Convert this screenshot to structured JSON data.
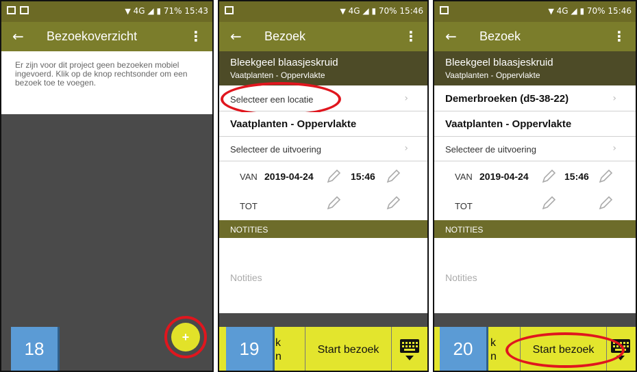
{
  "screens": [
    {
      "status": {
        "signal": "4G",
        "battery": "71%",
        "time": "15:43"
      },
      "title": "Bezoekoverzicht",
      "message": "Er zijn voor dit project geen bezoeken mobiel ingevoerd. Klik op de knop rechtsonder om een bezoek toe te voegen.",
      "fab_label": "+",
      "step": "18"
    },
    {
      "status": {
        "signal": "4G",
        "battery": "70%",
        "time": "15:46"
      },
      "title": "Bezoek",
      "species": "Bleekgeel blaasjeskruid",
      "subtitle": "Vaatplanten - Oppervlakte",
      "location": "Selecteer een locatie",
      "protocol": "Vaatplanten - Oppervlakte",
      "execution": "Selecteer de uitvoering",
      "van_label": "VAN",
      "van_date": "2019-04-24",
      "van_time": "15:46",
      "tot_label": "TOT",
      "notes_header": "NOTITIES",
      "notes_placeholder": "Notities",
      "left_button": "k n",
      "start_button": "Start bezoek",
      "step": "19"
    },
    {
      "status": {
        "signal": "4G",
        "battery": "70%",
        "time": "15:46"
      },
      "title": "Bezoek",
      "species": "Bleekgeel blaasjeskruid",
      "subtitle": "Vaatplanten - Oppervlakte",
      "location": "Demerbroeken (d5-38-22)",
      "protocol": "Vaatplanten - Oppervlakte",
      "execution": "Selecteer de uitvoering",
      "van_label": "VAN",
      "van_date": "2019-04-24",
      "van_time": "15:46",
      "tot_label": "TOT",
      "notes_header": "NOTITIES",
      "notes_placeholder": "Notities",
      "left_button": "k n",
      "start_button": "Start bezoek",
      "step": "20"
    }
  ],
  "icons": {
    "back": "arrow-left-icon",
    "menu": "kebab-menu-icon",
    "chevron": "chevron-right-icon",
    "pencil": "pencil-icon",
    "keyboard": "keyboard-icon",
    "add": "plus-icon"
  },
  "colors": {
    "appbar": "#7b7d2b",
    "subheader": "#4d4b27",
    "fab": "#e2e229",
    "highlight": "#e0161e",
    "step_badge": "#5b9bd5",
    "bottombar": "#e3e52d"
  }
}
